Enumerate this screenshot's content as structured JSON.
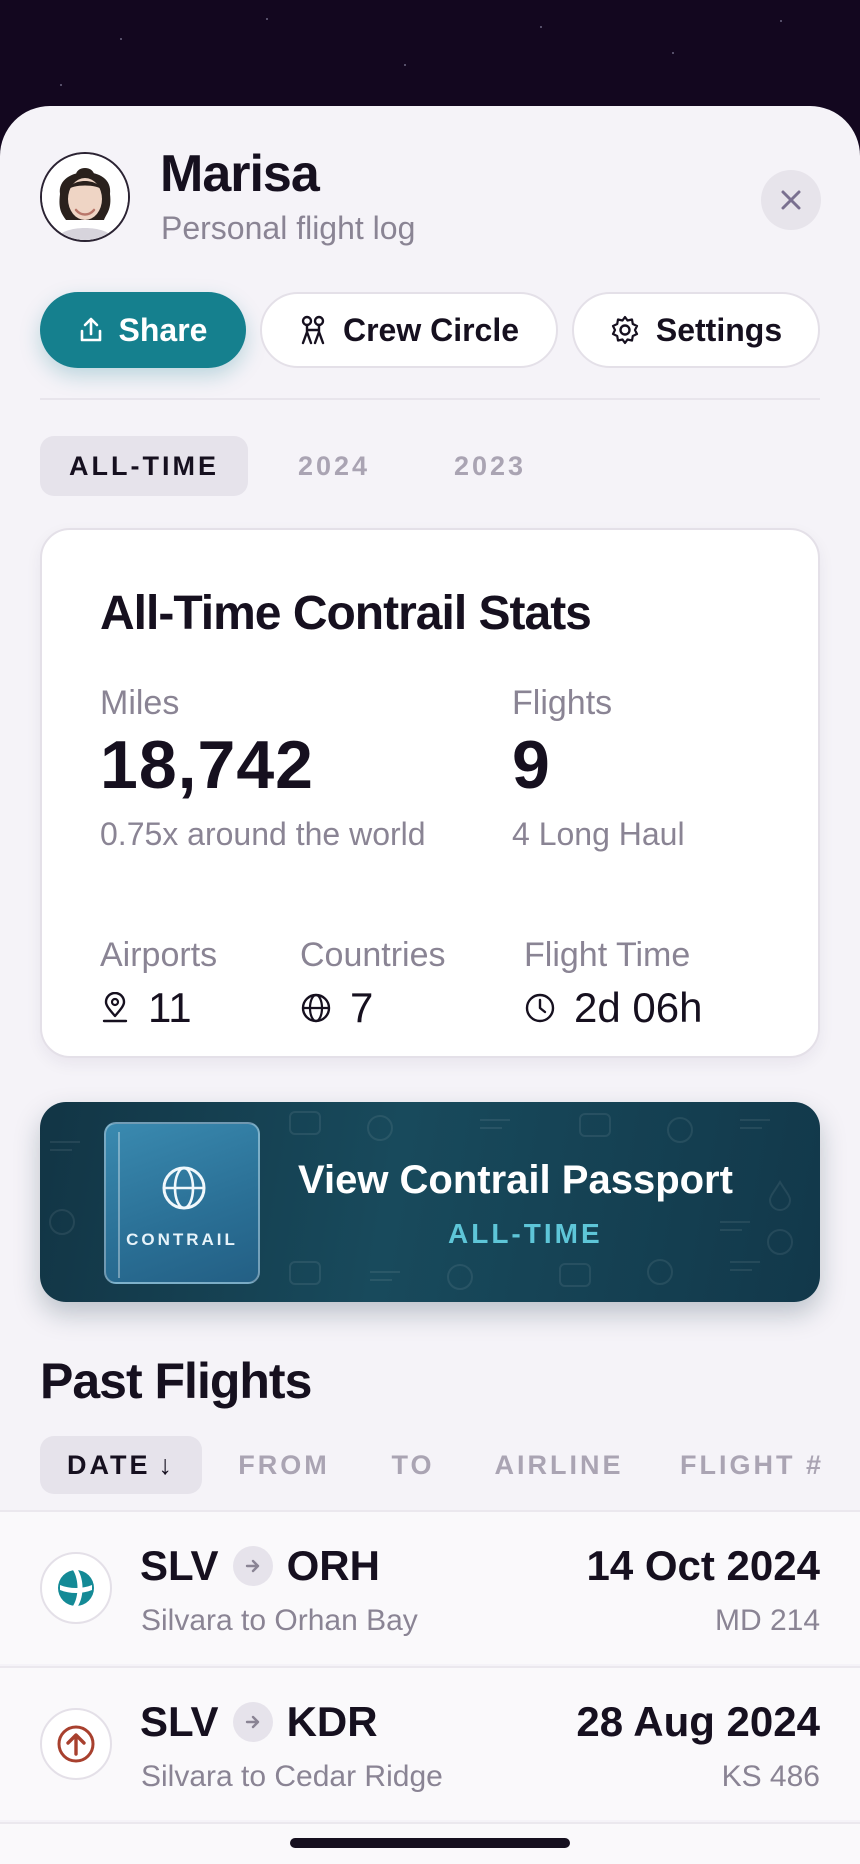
{
  "profile": {
    "name": "Marisa",
    "subtitle": "Personal flight log"
  },
  "actions": {
    "share": "Share",
    "crew_circle": "Crew Circle",
    "settings": "Settings"
  },
  "period_tabs": [
    {
      "label": "ALL-TIME",
      "active": true
    },
    {
      "label": "2024",
      "active": false
    },
    {
      "label": "2023",
      "active": false
    }
  ],
  "stats": {
    "title": "All-Time Contrail Stats",
    "miles": {
      "label": "Miles",
      "value": "18,742",
      "note": "0.75x around the world"
    },
    "flights": {
      "label": "Flights",
      "value": "9",
      "note": "4 Long Haul"
    },
    "airports": {
      "label": "Airports",
      "value": "11",
      "icon": "location-pin-icon"
    },
    "countries": {
      "label": "Countries",
      "value": "7",
      "icon": "globe-icon"
    },
    "flight_time": {
      "label": "Flight Time",
      "value": "2d 06h",
      "icon": "clock-icon"
    }
  },
  "passport": {
    "brand": "CONTRAIL",
    "title": "View Contrail Passport",
    "subtitle": "ALL-TIME"
  },
  "past_flights": {
    "title": "Past Flights",
    "sort_tabs": [
      {
        "label": "DATE",
        "active": true,
        "indicator": "↓"
      },
      {
        "label": "FROM",
        "active": false
      },
      {
        "label": "TO",
        "active": false
      },
      {
        "label": "AIRLINE",
        "active": false
      },
      {
        "label": "FLIGHT #",
        "active": false
      }
    ],
    "rows": [
      {
        "from": "SLV",
        "to": "ORH",
        "description": "Silvara to Orhan Bay",
        "date": "14 Oct 2024",
        "flight": "MD 214",
        "icon": "globe-airline-icon",
        "icon_color": "#148a96"
      },
      {
        "from": "SLV",
        "to": "KDR",
        "description": "Silvara to Cedar Ridge",
        "date": "28 Aug 2024",
        "flight": "KS 486",
        "icon": "arrow-up-airline-icon",
        "icon_color": "#a8402e"
      }
    ]
  },
  "colors": {
    "accent": "#15808e",
    "passport_label": "#5ec6d8",
    "background_dark": "#13071f"
  }
}
